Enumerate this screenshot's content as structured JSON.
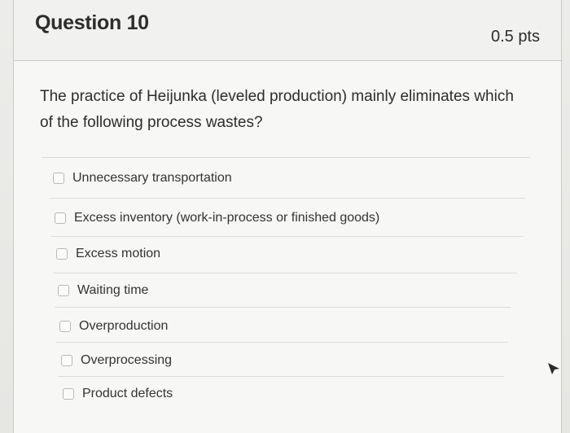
{
  "question": {
    "title": "Question 10",
    "points": "0.5 pts",
    "text": "The practice of Heijunka (leveled production) mainly eliminates which of the following process wastes?"
  },
  "answers": [
    {
      "label": "Unnecessary transportation"
    },
    {
      "label": "Excess inventory (work-in-process or finished goods)"
    },
    {
      "label": "Excess motion"
    },
    {
      "label": "Waiting time"
    },
    {
      "label": "Overproduction"
    },
    {
      "label": "Overprocessing"
    },
    {
      "label": "Product defects"
    }
  ],
  "icons": {
    "cursor": "cursor-arrow-icon",
    "radio": "radio-button-icon"
  },
  "colors": {
    "background": "#f7f7f5",
    "text": "#2d2d2d",
    "border": "#c8c8c5"
  }
}
